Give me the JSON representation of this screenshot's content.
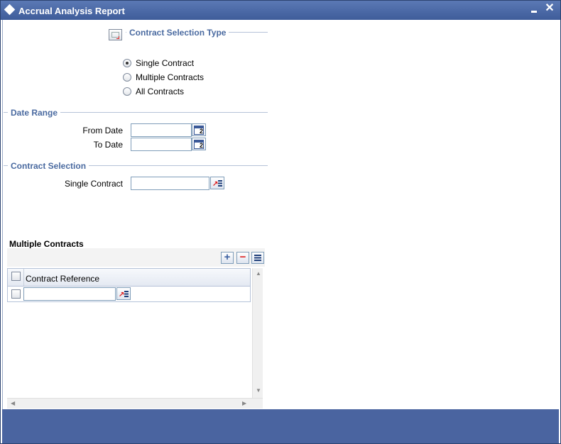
{
  "window": {
    "title": "Accrual Analysis Report",
    "minimize_icon": "minimize-icon",
    "close_icon": "close-icon",
    "close_glyph": "✕"
  },
  "contract_selection_type": {
    "title": "Contract Selection Type",
    "options": [
      {
        "label": "Single Contract",
        "checked": true
      },
      {
        "label": "Multiple Contracts",
        "checked": false
      },
      {
        "label": "All Contracts",
        "checked": false
      }
    ]
  },
  "date_range": {
    "title": "Date Range",
    "from_label": "From Date",
    "to_label": "To Date",
    "from_value": "",
    "to_value": "",
    "calendar_icon": "calendar-icon",
    "calendar_glyph": "2"
  },
  "contract_selection": {
    "title": "Contract Selection",
    "single_label": "Single Contract",
    "single_value": "",
    "lov_icon": "list-of-values-icon"
  },
  "multiple_contracts": {
    "title": "Multiple Contracts",
    "add_glyph": "+",
    "remove_glyph": "−",
    "column_header": "Contract Reference",
    "rows": [
      {
        "value": ""
      }
    ]
  },
  "colors": {
    "accent": "#4a64a0",
    "section_title": "#4a6aa0"
  }
}
